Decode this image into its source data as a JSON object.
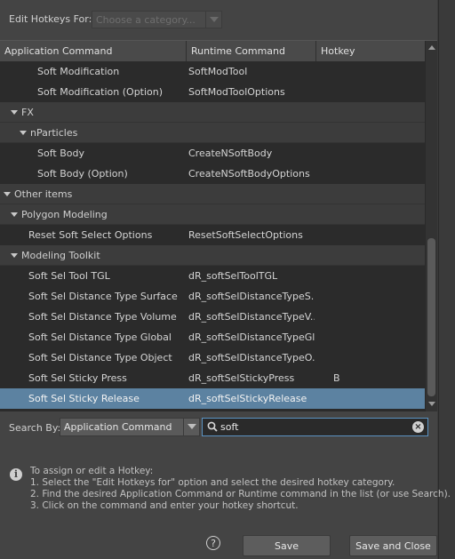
{
  "header": {
    "edit_hotkeys_label": "Edit Hotkeys For:",
    "category_placeholder": "Choose a category..."
  },
  "table": {
    "columns": [
      "Application Command",
      "Runtime Command",
      "Hotkey"
    ],
    "rows": [
      {
        "type": "item",
        "indent": 2,
        "command": "Soft Modification",
        "runtime": "SoftModTool",
        "hotkey": ""
      },
      {
        "type": "item",
        "indent": 2,
        "command": "Soft Modification (Option)",
        "runtime": "SoftModToolOptions",
        "hotkey": ""
      },
      {
        "type": "group",
        "indent": 1,
        "label": "FX"
      },
      {
        "type": "group",
        "indent": 2,
        "label": "nParticles"
      },
      {
        "type": "item",
        "indent": 2,
        "command": "Soft Body",
        "runtime": "CreateNSoftBody",
        "hotkey": ""
      },
      {
        "type": "item",
        "indent": 2,
        "command": "Soft Body (Option)",
        "runtime": "CreateNSoftBodyOptions",
        "hotkey": ""
      },
      {
        "type": "group",
        "indent": 0,
        "label": "Other items"
      },
      {
        "type": "group",
        "indent": 1,
        "label": "Polygon Modeling"
      },
      {
        "type": "item",
        "indent": 1,
        "command": "Reset Soft Select Options",
        "runtime": "ResetSoftSelectOptions",
        "hotkey": ""
      },
      {
        "type": "group",
        "indent": 1,
        "label": "Modeling Toolkit"
      },
      {
        "type": "item",
        "indent": 1,
        "command": "Soft Sel Tool TGL",
        "runtime": "dR_softSelToolTGL",
        "hotkey": ""
      },
      {
        "type": "item",
        "indent": 1,
        "command": "Soft Sel Distance Type Surface",
        "runtime": "dR_softSelDistanceTypeS...",
        "hotkey": ""
      },
      {
        "type": "item",
        "indent": 1,
        "command": "Soft Sel Distance Type Volume",
        "runtime": "dR_softSelDistanceTypeV...",
        "hotkey": ""
      },
      {
        "type": "item",
        "indent": 1,
        "command": "Soft Sel Distance Type Global",
        "runtime": "dR_softSelDistanceTypeGl...",
        "hotkey": ""
      },
      {
        "type": "item",
        "indent": 1,
        "command": "Soft Sel Distance Type Object",
        "runtime": "dR_softSelDistanceTypeO...",
        "hotkey": ""
      },
      {
        "type": "item",
        "indent": 1,
        "command": "Soft Sel Sticky Press",
        "runtime": "dR_softSelStickyPress",
        "hotkey": "B"
      },
      {
        "type": "item",
        "indent": 1,
        "command": "Soft Sel Sticky Release",
        "runtime": "dR_softSelStickyRelease",
        "hotkey": "",
        "selected": true
      }
    ]
  },
  "search": {
    "label": "Search By:",
    "mode": "Application Command",
    "query": "soft"
  },
  "info": {
    "lines": [
      "To assign or edit a Hotkey:",
      "1. Select the \"Edit Hotkeys for\" option and select the desired hotkey category.",
      "2. Find the desired Application Command or Runtime command in the list (or use Search).",
      "3. Click on the command and enter your hotkey shortcut."
    ]
  },
  "footer": {
    "help_glyph": "?",
    "save_label": "Save",
    "save_close_label": "Save and Close"
  },
  "colors": {
    "selection": "#5c82a1",
    "search_focus": "#5b93c2"
  }
}
